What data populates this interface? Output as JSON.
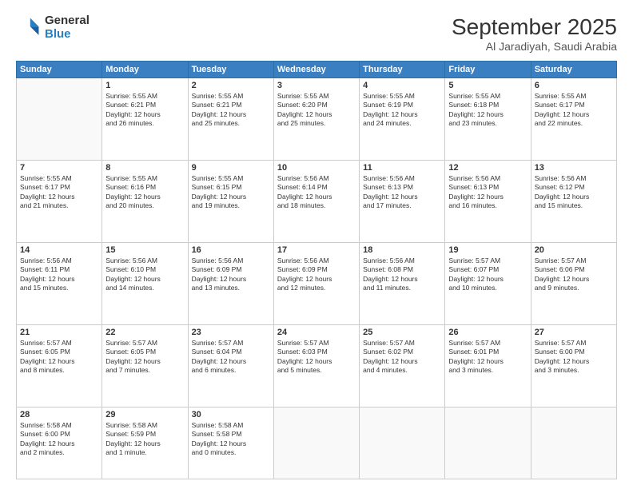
{
  "logo": {
    "general": "General",
    "blue": "Blue"
  },
  "title": "September 2025",
  "location": "Al Jaradiyah, Saudi Arabia",
  "days_header": [
    "Sunday",
    "Monday",
    "Tuesday",
    "Wednesday",
    "Thursday",
    "Friday",
    "Saturday"
  ],
  "weeks": [
    [
      {
        "num": "",
        "info": ""
      },
      {
        "num": "1",
        "info": "Sunrise: 5:55 AM\nSunset: 6:21 PM\nDaylight: 12 hours\nand 26 minutes."
      },
      {
        "num": "2",
        "info": "Sunrise: 5:55 AM\nSunset: 6:21 PM\nDaylight: 12 hours\nand 25 minutes."
      },
      {
        "num": "3",
        "info": "Sunrise: 5:55 AM\nSunset: 6:20 PM\nDaylight: 12 hours\nand 25 minutes."
      },
      {
        "num": "4",
        "info": "Sunrise: 5:55 AM\nSunset: 6:19 PM\nDaylight: 12 hours\nand 24 minutes."
      },
      {
        "num": "5",
        "info": "Sunrise: 5:55 AM\nSunset: 6:18 PM\nDaylight: 12 hours\nand 23 minutes."
      },
      {
        "num": "6",
        "info": "Sunrise: 5:55 AM\nSunset: 6:17 PM\nDaylight: 12 hours\nand 22 minutes."
      }
    ],
    [
      {
        "num": "7",
        "info": "Sunrise: 5:55 AM\nSunset: 6:17 PM\nDaylight: 12 hours\nand 21 minutes."
      },
      {
        "num": "8",
        "info": "Sunrise: 5:55 AM\nSunset: 6:16 PM\nDaylight: 12 hours\nand 20 minutes."
      },
      {
        "num": "9",
        "info": "Sunrise: 5:55 AM\nSunset: 6:15 PM\nDaylight: 12 hours\nand 19 minutes."
      },
      {
        "num": "10",
        "info": "Sunrise: 5:56 AM\nSunset: 6:14 PM\nDaylight: 12 hours\nand 18 minutes."
      },
      {
        "num": "11",
        "info": "Sunrise: 5:56 AM\nSunset: 6:13 PM\nDaylight: 12 hours\nand 17 minutes."
      },
      {
        "num": "12",
        "info": "Sunrise: 5:56 AM\nSunset: 6:13 PM\nDaylight: 12 hours\nand 16 minutes."
      },
      {
        "num": "13",
        "info": "Sunrise: 5:56 AM\nSunset: 6:12 PM\nDaylight: 12 hours\nand 15 minutes."
      }
    ],
    [
      {
        "num": "14",
        "info": "Sunrise: 5:56 AM\nSunset: 6:11 PM\nDaylight: 12 hours\nand 15 minutes."
      },
      {
        "num": "15",
        "info": "Sunrise: 5:56 AM\nSunset: 6:10 PM\nDaylight: 12 hours\nand 14 minutes."
      },
      {
        "num": "16",
        "info": "Sunrise: 5:56 AM\nSunset: 6:09 PM\nDaylight: 12 hours\nand 13 minutes."
      },
      {
        "num": "17",
        "info": "Sunrise: 5:56 AM\nSunset: 6:09 PM\nDaylight: 12 hours\nand 12 minutes."
      },
      {
        "num": "18",
        "info": "Sunrise: 5:56 AM\nSunset: 6:08 PM\nDaylight: 12 hours\nand 11 minutes."
      },
      {
        "num": "19",
        "info": "Sunrise: 5:57 AM\nSunset: 6:07 PM\nDaylight: 12 hours\nand 10 minutes."
      },
      {
        "num": "20",
        "info": "Sunrise: 5:57 AM\nSunset: 6:06 PM\nDaylight: 12 hours\nand 9 minutes."
      }
    ],
    [
      {
        "num": "21",
        "info": "Sunrise: 5:57 AM\nSunset: 6:05 PM\nDaylight: 12 hours\nand 8 minutes."
      },
      {
        "num": "22",
        "info": "Sunrise: 5:57 AM\nSunset: 6:05 PM\nDaylight: 12 hours\nand 7 minutes."
      },
      {
        "num": "23",
        "info": "Sunrise: 5:57 AM\nSunset: 6:04 PM\nDaylight: 12 hours\nand 6 minutes."
      },
      {
        "num": "24",
        "info": "Sunrise: 5:57 AM\nSunset: 6:03 PM\nDaylight: 12 hours\nand 5 minutes."
      },
      {
        "num": "25",
        "info": "Sunrise: 5:57 AM\nSunset: 6:02 PM\nDaylight: 12 hours\nand 4 minutes."
      },
      {
        "num": "26",
        "info": "Sunrise: 5:57 AM\nSunset: 6:01 PM\nDaylight: 12 hours\nand 3 minutes."
      },
      {
        "num": "27",
        "info": "Sunrise: 5:57 AM\nSunset: 6:00 PM\nDaylight: 12 hours\nand 3 minutes."
      }
    ],
    [
      {
        "num": "28",
        "info": "Sunrise: 5:58 AM\nSunset: 6:00 PM\nDaylight: 12 hours\nand 2 minutes."
      },
      {
        "num": "29",
        "info": "Sunrise: 5:58 AM\nSunset: 5:59 PM\nDaylight: 12 hours\nand 1 minute."
      },
      {
        "num": "30",
        "info": "Sunrise: 5:58 AM\nSunset: 5:58 PM\nDaylight: 12 hours\nand 0 minutes."
      },
      {
        "num": "",
        "info": ""
      },
      {
        "num": "",
        "info": ""
      },
      {
        "num": "",
        "info": ""
      },
      {
        "num": "",
        "info": ""
      }
    ]
  ]
}
